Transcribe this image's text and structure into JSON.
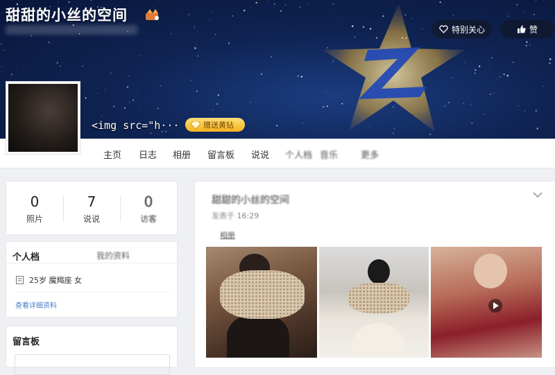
{
  "header": {
    "site_title": "甜甜的小丝的空间",
    "follow_label": "特别关心",
    "like_label": "赞",
    "nickname": "<img src=\"h···",
    "vip_label": "赠送黄钻"
  },
  "nav": {
    "items": [
      {
        "label": "主页"
      },
      {
        "label": "日志"
      },
      {
        "label": "相册"
      },
      {
        "label": "留言板"
      },
      {
        "label": "说说"
      },
      {
        "label": "个人档"
      },
      {
        "label": "音乐"
      },
      {
        "label": "更多"
      }
    ]
  },
  "stats": [
    {
      "value": "0",
      "label": "照片"
    },
    {
      "value": "7",
      "label": "说说"
    },
    {
      "value": "0",
      "label": "访客"
    }
  ],
  "profile": {
    "title": "个人档",
    "edit_hint": "我的资料",
    "info": "25岁  魔羯座  女",
    "more_link": "查看详细资料"
  },
  "guestbook": {
    "title": "留言板"
  },
  "feed": {
    "post_title": "甜甜的小丝的空间",
    "post_time_prefix": "发表于",
    "post_time": "16:29",
    "tag": "相册"
  },
  "colors": {
    "banner_bg": "#0f2454",
    "vip_gold": "#f2b21c",
    "link_blue": "#4a7ccc"
  },
  "icons": [
    "crown-icon",
    "heart-plus-icon",
    "thumbs-up-icon",
    "diamond-icon",
    "document-icon",
    "chevron-down-icon",
    "play-icon"
  ]
}
